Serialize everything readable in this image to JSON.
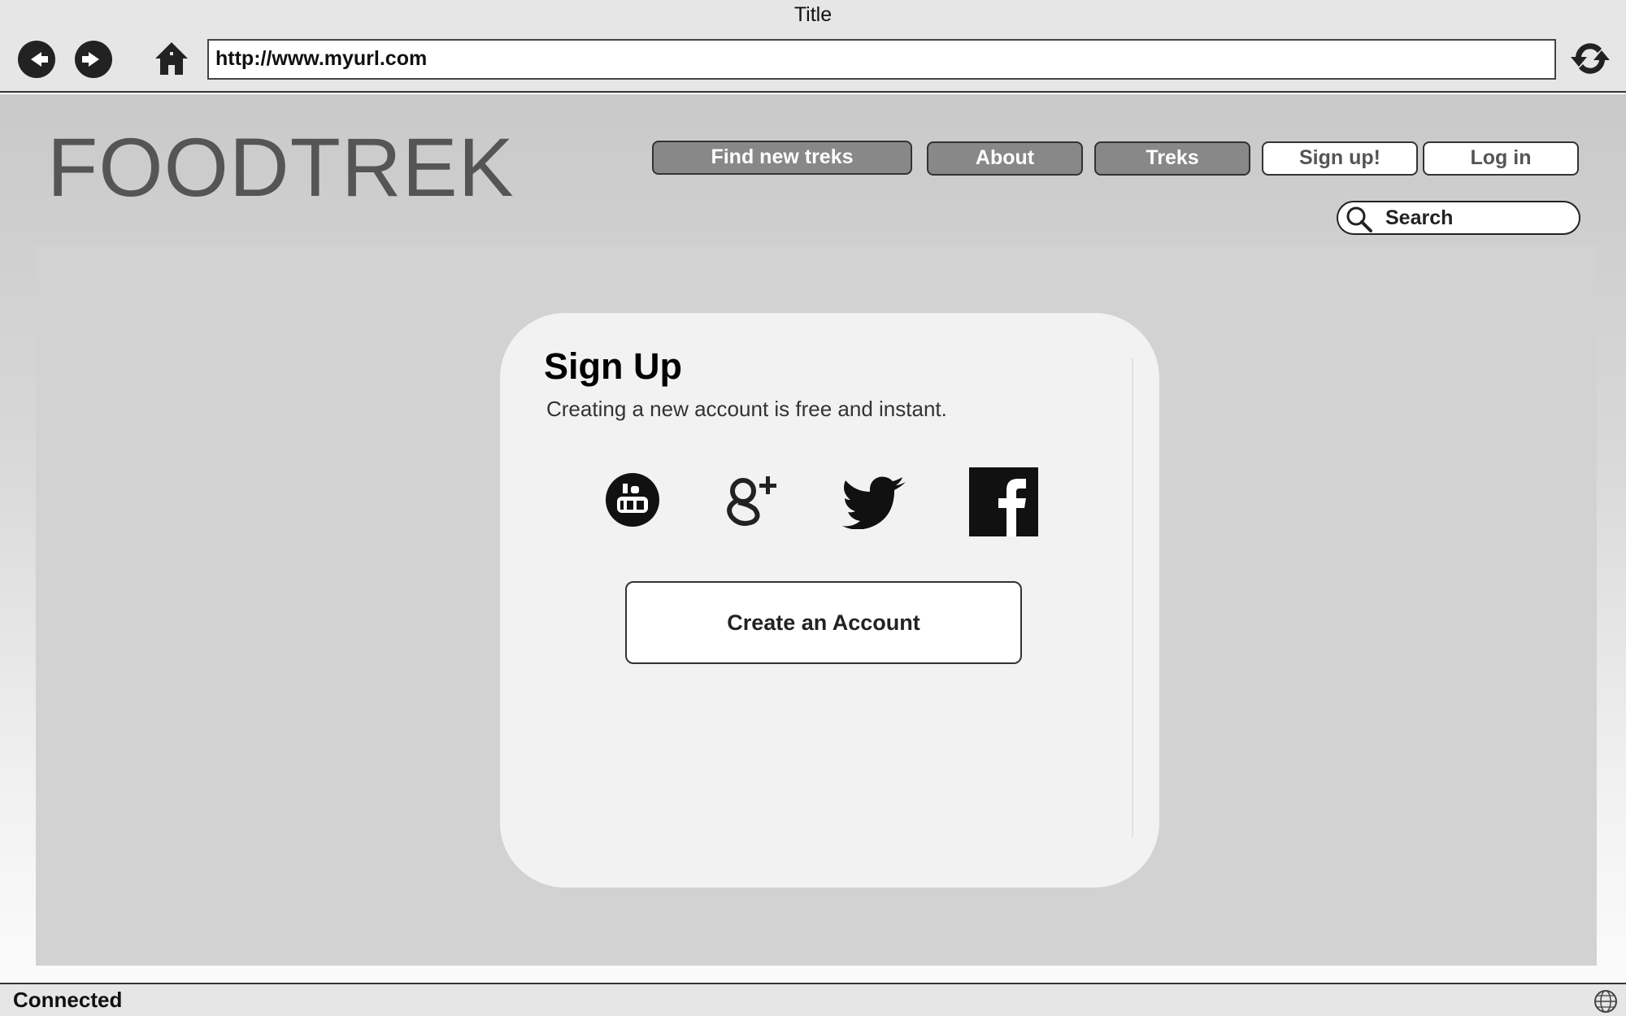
{
  "window": {
    "title": "Title"
  },
  "toolbar": {
    "url": "http://www.myurl.com"
  },
  "site": {
    "logo": "FOODTREK"
  },
  "nav": {
    "items": [
      {
        "label": "Find new treks",
        "style": "dark"
      },
      {
        "label": "About",
        "style": "dark"
      },
      {
        "label": "Treks",
        "style": "dark"
      },
      {
        "label": "Sign up!",
        "style": "light"
      },
      {
        "label": "Log in",
        "style": "light"
      }
    ]
  },
  "search": {
    "label": "Search"
  },
  "signup": {
    "title": "Sign Up",
    "subtitle": "Creating a new account is free and instant.",
    "social": [
      {
        "icon": "youtube-icon"
      },
      {
        "icon": "google-plus-icon"
      },
      {
        "icon": "twitter-icon"
      },
      {
        "icon": "facebook-icon"
      }
    ],
    "create_label": "Create an Account"
  },
  "status": {
    "text": "Connected"
  },
  "colors": {
    "chrome": "#e6e6e6",
    "nav_dark": "#888888",
    "panel": "#d2d2d2",
    "card": "#f2f2f2"
  }
}
